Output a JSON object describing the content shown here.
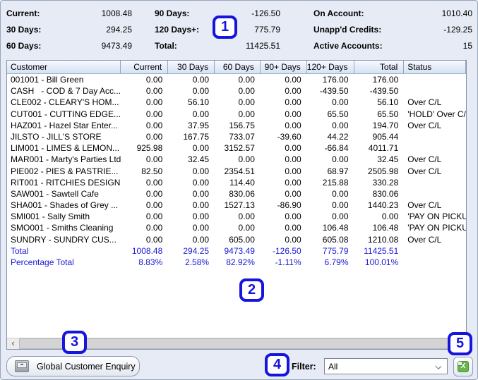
{
  "summary": {
    "columns": [
      [
        {
          "label": "Current:",
          "value": "1008.48"
        },
        {
          "label": "30 Days:",
          "value": "294.25"
        },
        {
          "label": "60 Days:",
          "value": "9473.49"
        }
      ],
      [
        {
          "label": "90 Days:",
          "value": "-126.50"
        },
        {
          "label": "120 Days+:",
          "value": "775.79"
        },
        {
          "label": "Total:",
          "value": "11425.51"
        }
      ],
      [
        {
          "label": "On Account:",
          "value": "1010.40"
        },
        {
          "label": "Unapp'd Credits:",
          "value": "-129.25"
        },
        {
          "label": "Active Accounts:",
          "value": "15"
        }
      ]
    ]
  },
  "table": {
    "columns": [
      "Customer",
      "Current",
      "30 Days",
      "60 Days",
      "90+ Days",
      "120+ Days",
      "Total",
      "Status"
    ],
    "rows": [
      [
        "001001 - Bill Green",
        "0.00",
        "0.00",
        "0.00",
        "0.00",
        "176.00",
        "176.00",
        ""
      ],
      [
        "CASH   - COD & 7 Day Acc...",
        "0.00",
        "0.00",
        "0.00",
        "0.00",
        "-439.50",
        "-439.50",
        ""
      ],
      [
        "CLE002 - CLEARY'S HOM...",
        "0.00",
        "56.10",
        "0.00",
        "0.00",
        "0.00",
        "56.10",
        "Over C/L"
      ],
      [
        "CUT001 - CUTTING EDGE...",
        "0.00",
        "0.00",
        "0.00",
        "0.00",
        "65.50",
        "65.50",
        "'HOLD' Over C/L"
      ],
      [
        "HAZ001 - Hazel Star Enter...",
        "0.00",
        "37.95",
        "156.75",
        "0.00",
        "0.00",
        "194.70",
        "Over C/L"
      ],
      [
        "JILSTO - JILL'S STORE",
        "0.00",
        "167.75",
        "733.07",
        "-39.60",
        "44.22",
        "905.44",
        ""
      ],
      [
        "LIM001 - LIMES & LEMON...",
        "925.98",
        "0.00",
        "3152.57",
        "0.00",
        "-66.84",
        "4011.71",
        ""
      ],
      [
        "MAR001 - Marty's Parties Ltd",
        "0.00",
        "32.45",
        "0.00",
        "0.00",
        "0.00",
        "32.45",
        "Over C/L"
      ],
      [
        "PIE002 - PIES & PASTRIE...",
        "82.50",
        "0.00",
        "2354.51",
        "0.00",
        "68.97",
        "2505.98",
        "Over C/L"
      ],
      [
        "RIT001 - RITCHIES DESIGN",
        "0.00",
        "0.00",
        "114.40",
        "0.00",
        "215.88",
        "330.28",
        ""
      ],
      [
        "SAW001 - Sawtell Cafe",
        "0.00",
        "0.00",
        "830.06",
        "0.00",
        "0.00",
        "830.06",
        ""
      ],
      [
        "SHA001 - Shades of Grey ...",
        "0.00",
        "0.00",
        "1527.13",
        "-86.90",
        "0.00",
        "1440.23",
        "Over C/L"
      ],
      [
        "SMI001 - Sally Smith",
        "0.00",
        "0.00",
        "0.00",
        "0.00",
        "0.00",
        "0.00",
        "'PAY ON PICKUP'"
      ],
      [
        "SMO001 - Smiths Cleaning",
        "0.00",
        "0.00",
        "0.00",
        "0.00",
        "106.48",
        "106.48",
        "'PAY ON PICKUP'"
      ],
      [
        "SUNDRY - SUNDRY CUS...",
        "0.00",
        "0.00",
        "605.00",
        "0.00",
        "605.08",
        "1210.08",
        "Over C/L"
      ]
    ],
    "total_row": [
      "Total",
      "1008.48",
      "294.25",
      "9473.49",
      "-126.50",
      "775.79",
      "11425.51",
      ""
    ],
    "percentage_row": [
      "Percentage Total",
      "8.83%",
      "2.58%",
      "82.92%",
      "-1.11%",
      "6.79%",
      "100.01%",
      ""
    ]
  },
  "annotations": [
    "1",
    "2",
    "3",
    "4",
    "5"
  ],
  "scrollbar": {
    "left_arrow": "‹"
  },
  "footer": {
    "enquiry_button": "Global Customer Enquiry",
    "filter_label": "Filter:",
    "filter_value": "All"
  },
  "icons": {
    "enquiry_icon": "card-file-icon",
    "export_icon": "excel-export-icon",
    "export_glyph": "X"
  },
  "colors": {
    "annotation_blue": "#1515DD",
    "totals_blue": "#1A1AD4",
    "excel_green": "#6CB44C",
    "window_background": "#E7EBF5"
  }
}
